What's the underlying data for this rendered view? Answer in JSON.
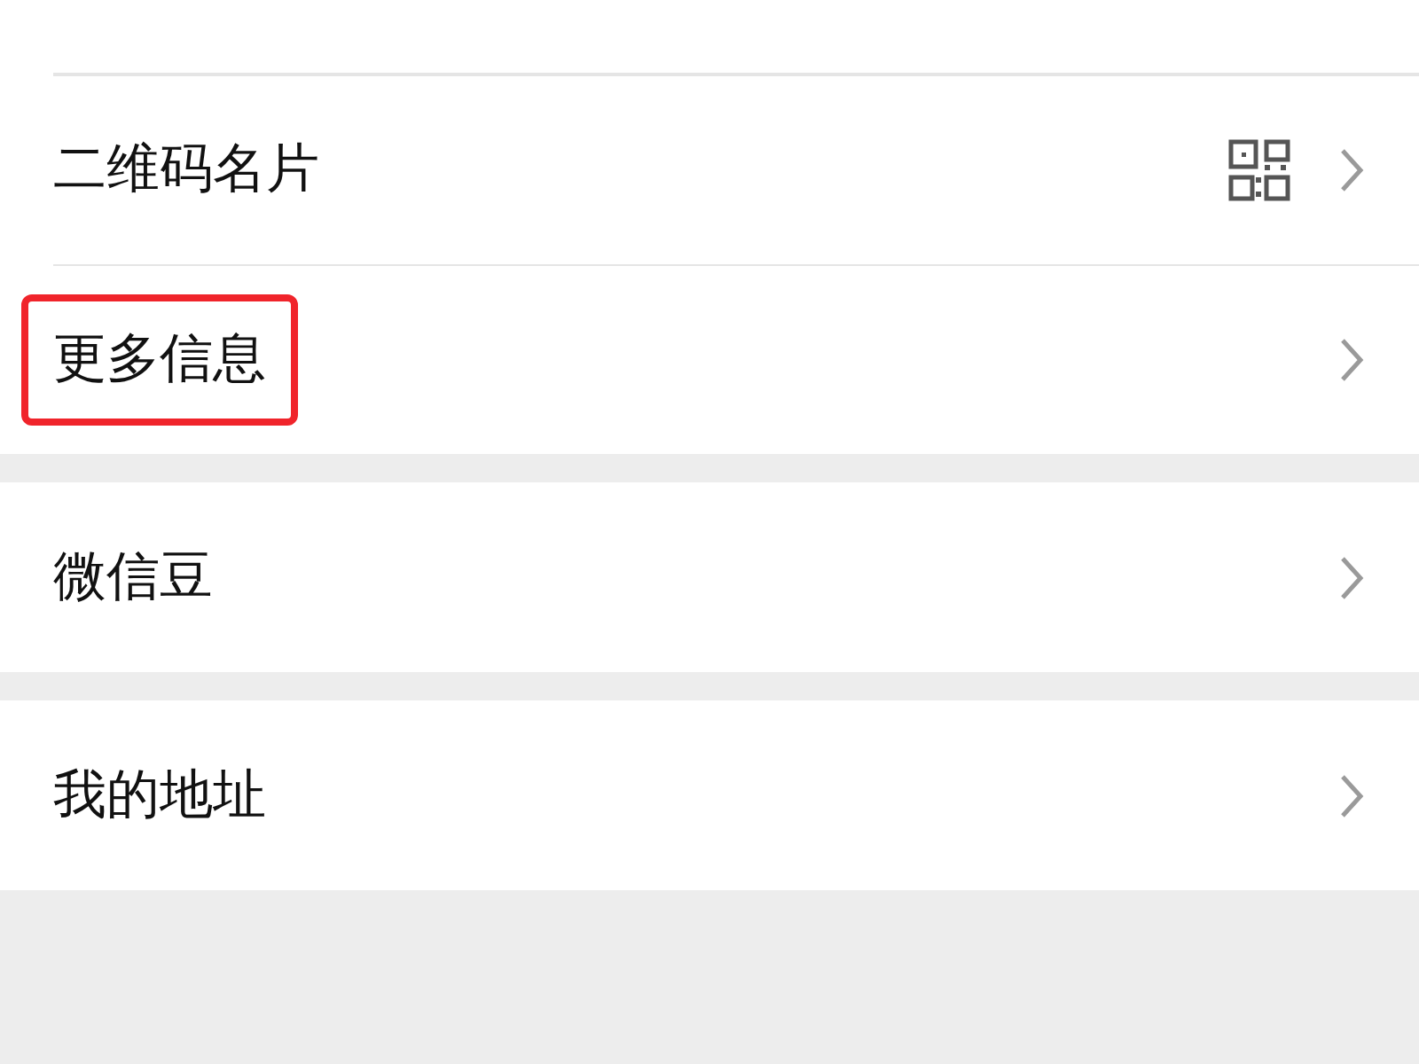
{
  "groups": [
    {
      "items": [
        {
          "label": "二维码名片",
          "kind": "qr",
          "highlighted": false
        },
        {
          "label": "更多信息",
          "kind": "plain",
          "highlighted": true
        }
      ]
    },
    {
      "items": [
        {
          "label": "微信豆",
          "kind": "plain",
          "highlighted": false
        }
      ]
    },
    {
      "items": [
        {
          "label": "我的地址",
          "kind": "plain",
          "highlighted": false
        }
      ]
    }
  ]
}
